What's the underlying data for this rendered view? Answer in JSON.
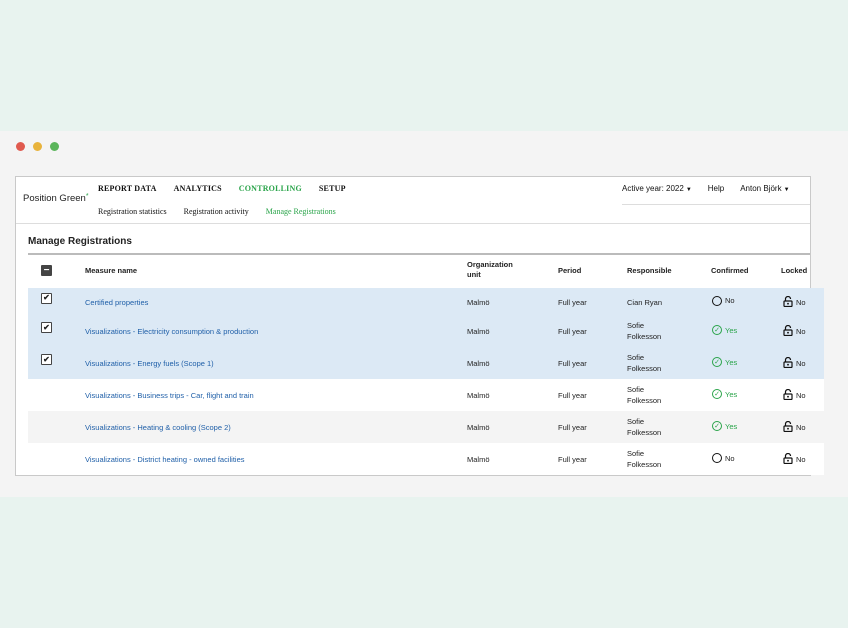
{
  "window": {
    "dots": [
      {
        "name": "close-dot",
        "color": "#e05a4f"
      },
      {
        "name": "minimize-dot",
        "color": "#e8b33c"
      },
      {
        "name": "maximize-dot",
        "color": "#5bb55b"
      }
    ]
  },
  "brand": {
    "name": "Position Green",
    "mark": "*",
    "accent": "#2aa44a",
    "link": "#1f5fa8",
    "selected_row": "#dce9f5"
  },
  "nav": {
    "main": [
      "REPORT DATA",
      "ANALYTICS",
      "CONTROLLING",
      "SETUP"
    ],
    "sub": [
      "Registration statistics",
      "Registration activity",
      "Manage Registrations"
    ],
    "active_year": "Active year: 2022",
    "help": "Help",
    "user": "Anton Björk"
  },
  "page": {
    "title": "Manage Registrations"
  },
  "table": {
    "headers": {
      "measure": "Measure name",
      "org_line1": "Organization",
      "org_line2": "unit",
      "period": "Period",
      "responsible": "Responsible",
      "confirmed": "Confirmed",
      "locked": "Locked"
    },
    "rows": [
      {
        "checked": "✔",
        "measure": "Certified properties",
        "org": "Malmö",
        "period": "Full year",
        "resp1": "Cian Ryan",
        "resp2": "",
        "confirmed": "No",
        "locked": "No"
      },
      {
        "checked": "✔",
        "measure": "Visualizations - Electricity consumption & production",
        "org": "Malmö",
        "period": "Full year",
        "resp1": "Sofie",
        "resp2": "Folkesson",
        "confirmed": "Yes",
        "locked": "No"
      },
      {
        "checked": "✔",
        "measure": "Visualizations - Energy fuels (Scope 1)",
        "org": "Malmö",
        "period": "Full year",
        "resp1": "Sofie",
        "resp2": "Folkesson",
        "confirmed": "Yes",
        "locked": "No"
      },
      {
        "checked": "",
        "measure": "Visualizations - Business trips - Car, flight and train",
        "org": "Malmö",
        "period": "Full year",
        "resp1": "Sofie",
        "resp2": "Folkesson",
        "confirmed": "Yes",
        "locked": "No"
      },
      {
        "checked": "",
        "measure": "Visualizations - Heating & cooling (Scope 2)",
        "org": "Malmö",
        "period": "Full year",
        "resp1": "Sofie",
        "resp2": "Folkesson",
        "confirmed": "Yes",
        "locked": "No"
      },
      {
        "checked": "",
        "measure": "Visualizations - District heating - owned facilities",
        "org": "Malmö",
        "period": "Full year",
        "resp1": "Sofie",
        "resp2": "Folkesson",
        "confirmed": "No",
        "locked": "No"
      }
    ]
  }
}
